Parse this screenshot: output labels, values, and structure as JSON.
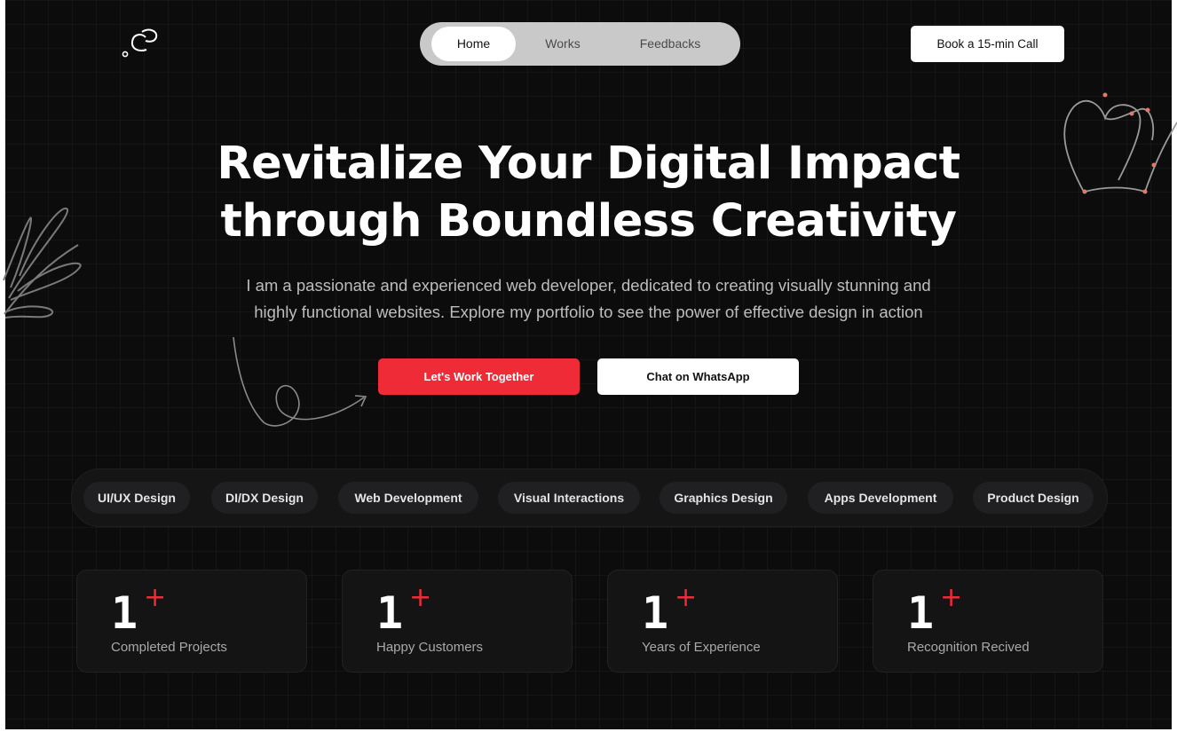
{
  "header": {
    "nav": [
      {
        "label": "Home",
        "active": true
      },
      {
        "label": "Works",
        "active": false
      },
      {
        "label": "Feedbacks",
        "active": false
      }
    ],
    "book_call_label": "Book a 15-min Call"
  },
  "hero": {
    "title_line1": "Revitalize Your Digital Impact",
    "title_line2": "through Boundless Creativity",
    "subtitle_line1": "I am a passionate and experienced web developer, dedicated to creating visually stunning and",
    "subtitle_line2": "highly functional websites. Explore my portfolio to see the power of effective design in action",
    "primary_cta": "Let's Work Together",
    "secondary_cta": "Chat on WhatsApp"
  },
  "skills": [
    "UI/UX Design",
    "DI/DX Design",
    "Web Development",
    "Visual Interactions",
    "Graphics Design",
    "Apps Development",
    "Product Design"
  ],
  "stats": [
    {
      "value": "1",
      "suffix": "+",
      "label": "Completed Projects"
    },
    {
      "value": "1",
      "suffix": "+",
      "label": "Happy Customers"
    },
    {
      "value": "1",
      "suffix": "+",
      "label": "Years of Experience"
    },
    {
      "value": "1",
      "suffix": "+",
      "label": "Recognition Recived"
    }
  ],
  "colors": {
    "background": "#0c0c0d",
    "accent": "#ef2b37",
    "card": "#141415",
    "chip": "#202022"
  },
  "icons": {
    "logo": "brand-logo-icon",
    "doodle_left": "leaf-doodle-icon",
    "doodle_right": "heart-doodle-icon",
    "doodle_arrow": "curly-arrow-icon"
  }
}
